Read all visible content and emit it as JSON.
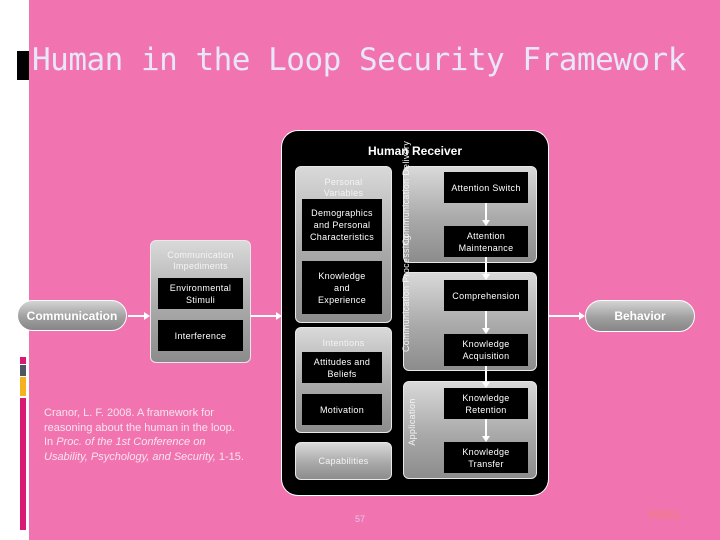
{
  "slide": {
    "title": "Human in the Loop Security Framework",
    "page_number": "57",
    "copyright": "©2011",
    "colors": {
      "background": "#F174B0",
      "title": "#E8E6FA",
      "strip": [
        "#D81B72",
        "#4E5563",
        "#F3B21E",
        "#D81B72"
      ]
    }
  },
  "diagram": {
    "input": "Communication",
    "output": "Behavior",
    "impediments": {
      "label": "Communication Impediments",
      "items": [
        "Environmental Stimuli",
        "Interference"
      ]
    },
    "receiver": {
      "title": "Human Receiver",
      "personal_variables": {
        "label": "Personal Variables",
        "items": [
          "Demographics and Personal Characteristics",
          "Knowledge and Experience"
        ]
      },
      "intentions": {
        "label": "Intentions",
        "items": [
          "Attitudes and Beliefs",
          "Motivation"
        ]
      },
      "capabilities": "Capabilities",
      "stages": [
        {
          "label": "Communication Delivery",
          "steps": [
            "Attention Switch",
            "Attention Maintenance"
          ]
        },
        {
          "label": "Communication Processing",
          "steps": [
            "Comprehension",
            "Knowledge Acquisition"
          ]
        },
        {
          "label": "Application",
          "steps": [
            "Knowledge Retention",
            "Knowledge Transfer"
          ]
        }
      ]
    }
  },
  "citation": {
    "line1": "Cranor, L. F. 2008. A framework for",
    "line2": "reasoning about the human in the loop.",
    "line3_prefix": "In ",
    "line3_italic": "Proc. of the 1st Conference on",
    "line4_italic": "Usability, Psychology, and Security,",
    "line4_suffix": " 1-15."
  }
}
